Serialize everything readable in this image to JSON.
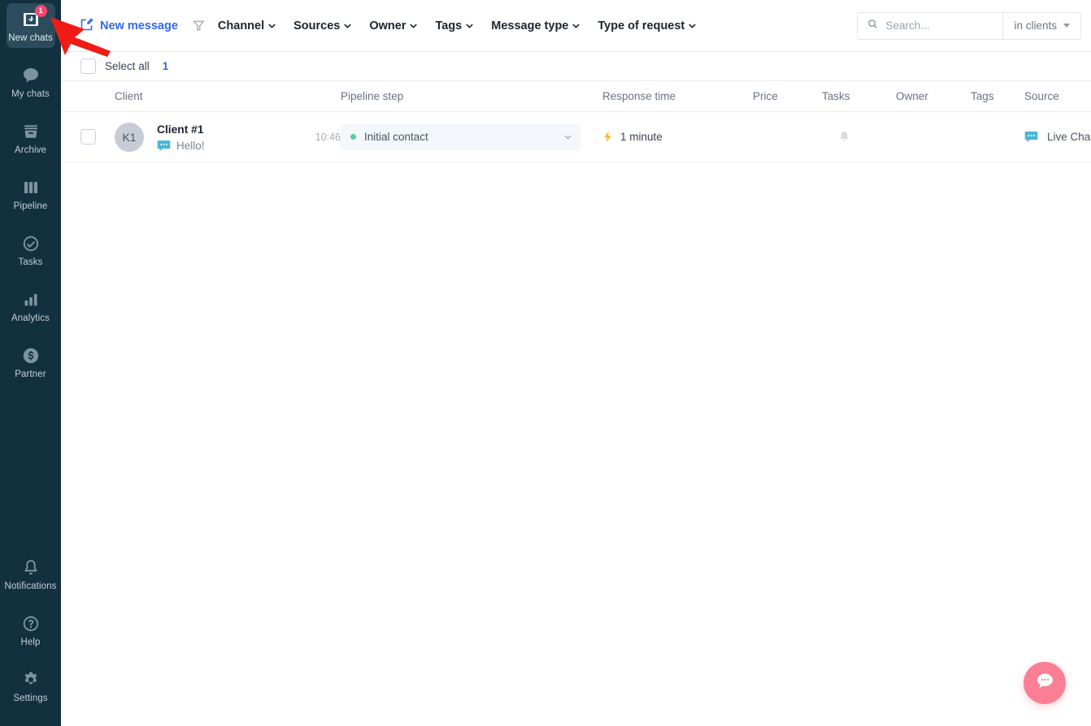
{
  "sidebar": {
    "top_items": [
      {
        "label": "New chats",
        "icon": "inbox-down-icon",
        "active": true,
        "badge": "1"
      },
      {
        "label": "My chats",
        "icon": "speech-bubble-icon",
        "active": false,
        "badge": ""
      },
      {
        "label": "Archive",
        "icon": "archive-box-icon",
        "active": false,
        "badge": ""
      },
      {
        "label": "Pipeline",
        "icon": "columns-icon",
        "active": false,
        "badge": ""
      },
      {
        "label": "Tasks",
        "icon": "check-circle-icon",
        "active": false,
        "badge": ""
      },
      {
        "label": "Analytics",
        "icon": "bar-chart-icon",
        "active": false,
        "badge": ""
      },
      {
        "label": "Partner",
        "icon": "dollar-circle-icon",
        "active": false,
        "badge": ""
      }
    ],
    "bottom_items": [
      {
        "label": "Notifications",
        "icon": "bell-icon",
        "active": false,
        "badge": ""
      },
      {
        "label": "Help",
        "icon": "question-circle-icon",
        "active": false,
        "badge": ""
      },
      {
        "label": "Settings",
        "icon": "gear-icon",
        "active": false,
        "badge": ""
      }
    ]
  },
  "toolbar": {
    "new_message_label": "New message",
    "new_message_icon": "compose-icon",
    "filter_icon": "funnel-icon",
    "filters": [
      {
        "label": "Channel"
      },
      {
        "label": "Sources"
      },
      {
        "label": "Owner"
      },
      {
        "label": "Tags"
      },
      {
        "label": "Message type"
      },
      {
        "label": "Type of request"
      }
    ],
    "search": {
      "icon": "search-icon",
      "placeholder": "Search...",
      "value": "",
      "scope_label": "in clients"
    }
  },
  "select_bar": {
    "label": "Select all",
    "count": "1",
    "checked": false
  },
  "table": {
    "headers": {
      "client": "Client",
      "pipeline_step": "Pipeline step",
      "response_time": "Response time",
      "price": "Price",
      "tasks": "Tasks",
      "owner": "Owner",
      "tags": "Tags",
      "source": "Source"
    },
    "rows": [
      {
        "checked": false,
        "avatar_initials": "K1",
        "client_name": "Client #1",
        "message_icon": "live-chat-icon",
        "message_preview": "Hello!",
        "time": "10:46",
        "pipeline_step": "Initial contact",
        "pipeline_dot_color": "#53d295",
        "response_time": "1 minute",
        "response_icon": "lightning-bolt-icon",
        "price": "",
        "tasks_icon": "bell-icon",
        "owner": "",
        "tags": "",
        "source_icon": "live-chat-icon",
        "source": "Live Chat"
      }
    ]
  },
  "floating_widget": {
    "icon": "chat-bubble-icon",
    "color": "#fb7f94"
  },
  "annotation": {
    "type": "arrow",
    "color": "#ee1c15"
  },
  "colors": {
    "sidebar_bg": "#13303f",
    "sidebar_active": "#2c4b5c",
    "accent_blue": "#3466ec",
    "badge_pink": "#f6466e",
    "status_green": "#53d295",
    "bolt_yellow": "#f9bc2a",
    "livechat_blue": "#4bb6d8"
  }
}
